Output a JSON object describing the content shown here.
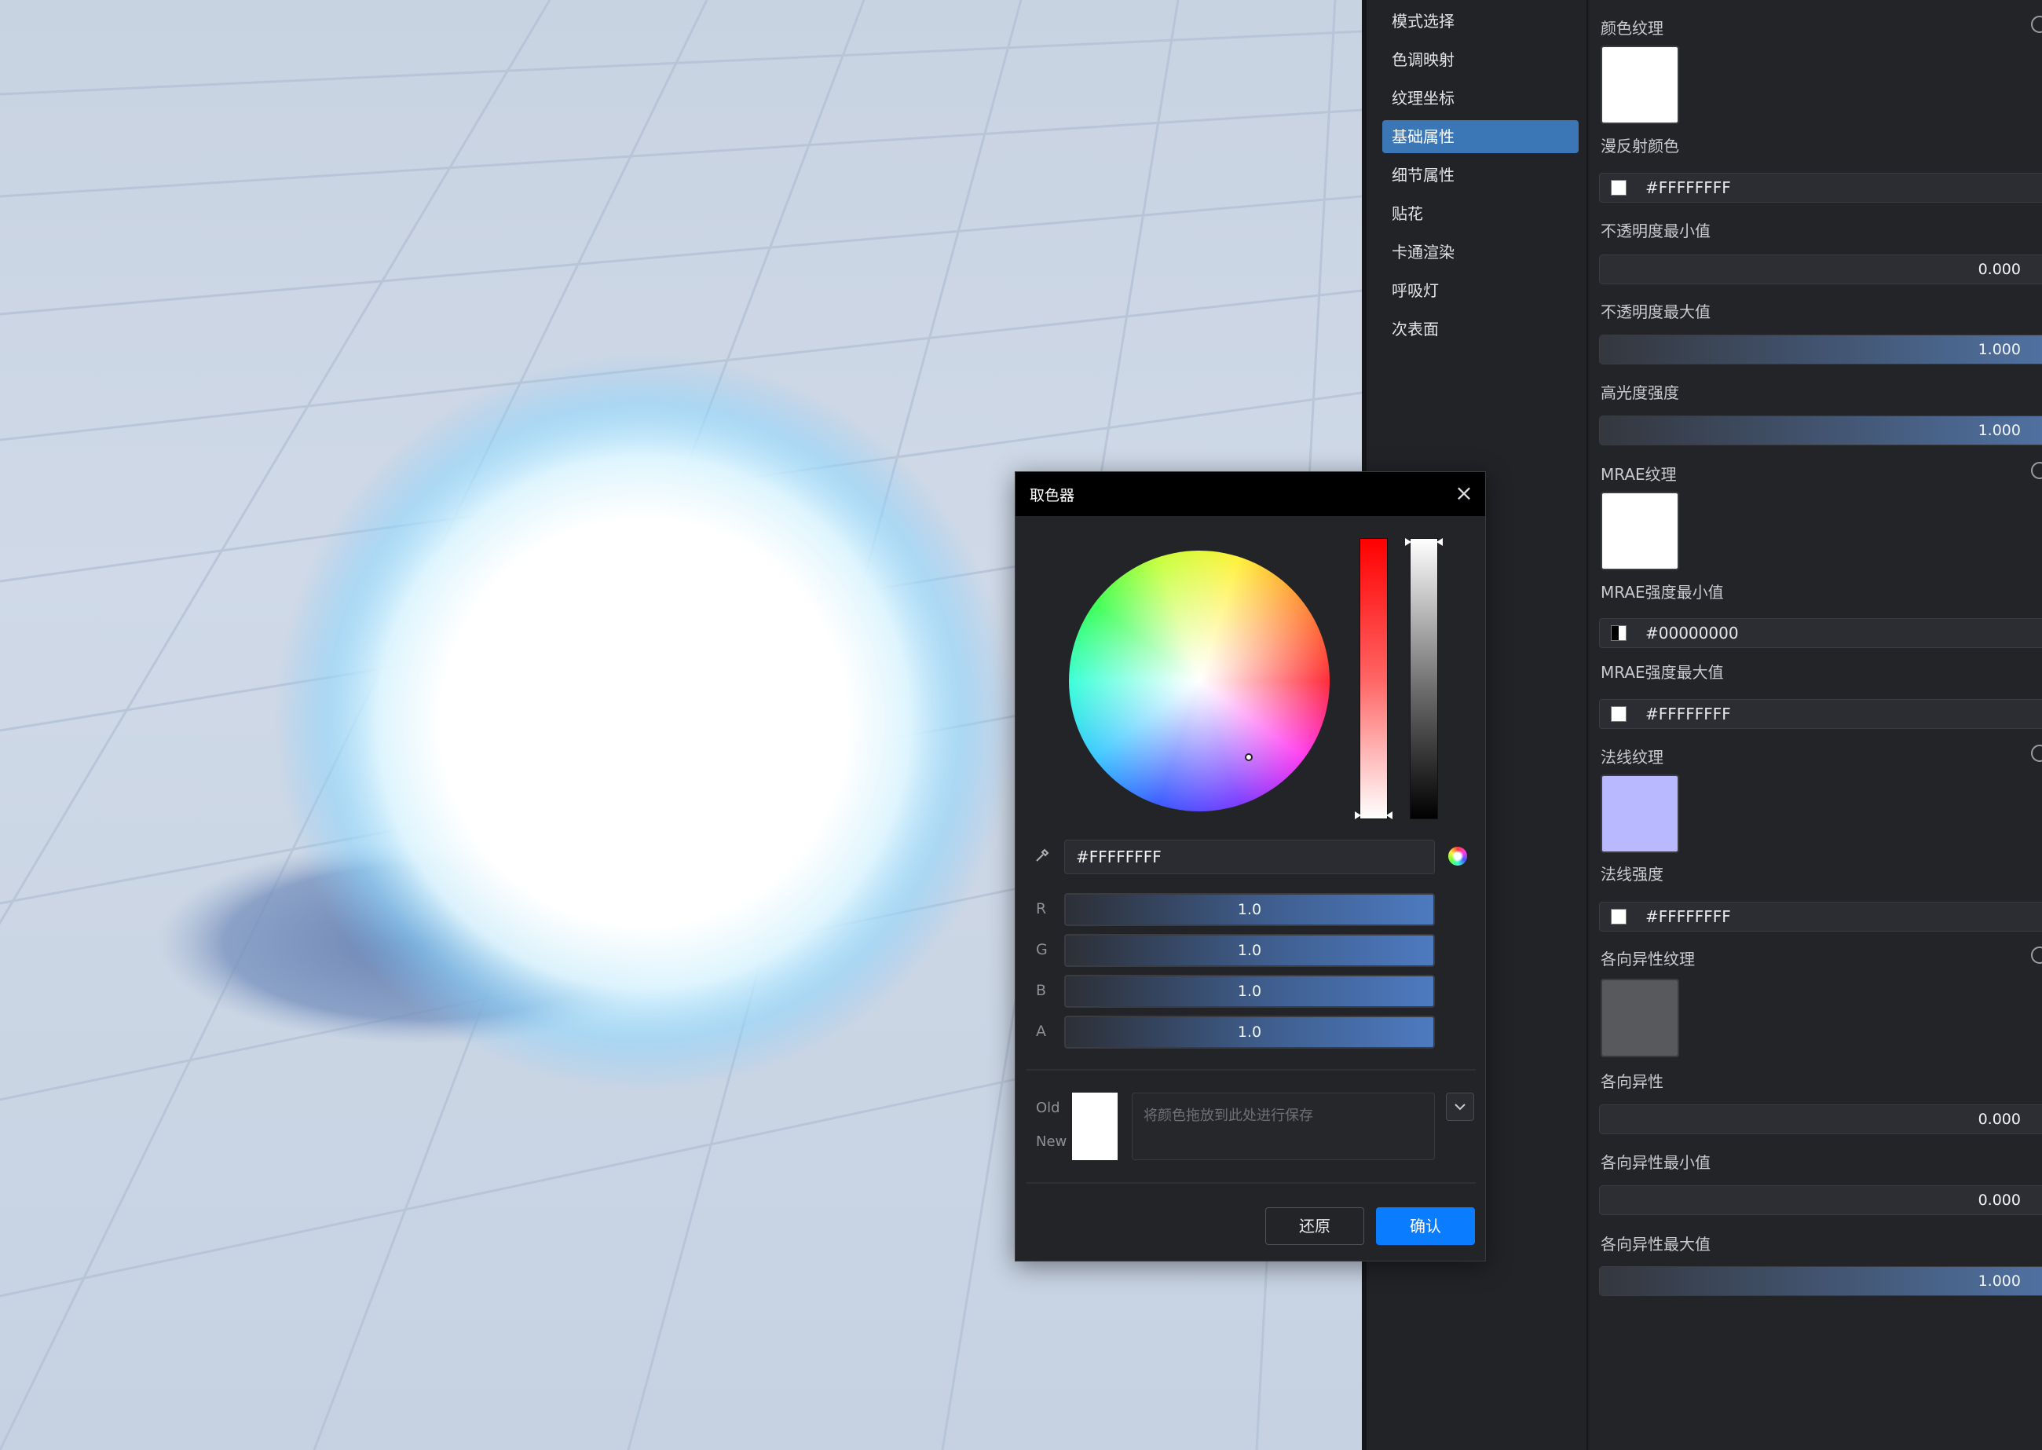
{
  "nav": {
    "items": [
      {
        "label": "模式选择",
        "active": false
      },
      {
        "label": "色调映射",
        "active": false
      },
      {
        "label": "纹理坐标",
        "active": false
      },
      {
        "label": "基础属性",
        "active": true
      },
      {
        "label": "细节属性",
        "active": false
      },
      {
        "label": "贴花",
        "active": false
      },
      {
        "label": "卡通渲染",
        "active": false
      },
      {
        "label": "呼吸灯",
        "active": false
      },
      {
        "label": "次表面",
        "active": false
      }
    ]
  },
  "props": {
    "color_texture_label": "颜色纹理",
    "diffuse_color_label": "漫反射颜色",
    "diffuse_color_value": "#FFFFFFFF",
    "opacity_min_label": "不透明度最小值",
    "opacity_min_value": "0.000",
    "opacity_max_label": "不透明度最大值",
    "opacity_max_value": "1.000",
    "specular_label": "高光度强度",
    "specular_value": "1.000",
    "mrae_texture_label": "MRAE纹理",
    "mrae_min_label": "MRAE强度最小值",
    "mrae_min_value": "#00000000",
    "mrae_max_label": "MRAE强度最大值",
    "mrae_max_value": "#FFFFFFFF",
    "normal_texture_label": "法线纹理",
    "normal_strength_label": "法线强度",
    "normal_strength_value": "#FFFFFFFF",
    "aniso_texture_label": "各向异性纹理",
    "aniso_label": "各向异性",
    "aniso_value": "0.000",
    "aniso_min_label": "各向异性最小值",
    "aniso_min_value": "0.000",
    "aniso_max_label": "各向异性最大值",
    "aniso_max_value": "1.000"
  },
  "picker": {
    "title": "取色器",
    "hex": "#FFFFFFFF",
    "channels": [
      {
        "name": "R",
        "value": "1.0"
      },
      {
        "name": "G",
        "value": "1.0"
      },
      {
        "name": "B",
        "value": "1.0"
      },
      {
        "name": "A",
        "value": "1.0"
      }
    ],
    "old_label": "Old",
    "new_label": "New",
    "save_placeholder": "将颜色拖放到此处进行保存",
    "reset_label": "还原",
    "confirm_label": "确认"
  },
  "colors": {
    "accent": "#3b76b6",
    "confirm": "#0a7cff",
    "normal_texture": "#b9b9ff",
    "aniso_texture": "#58595d"
  }
}
